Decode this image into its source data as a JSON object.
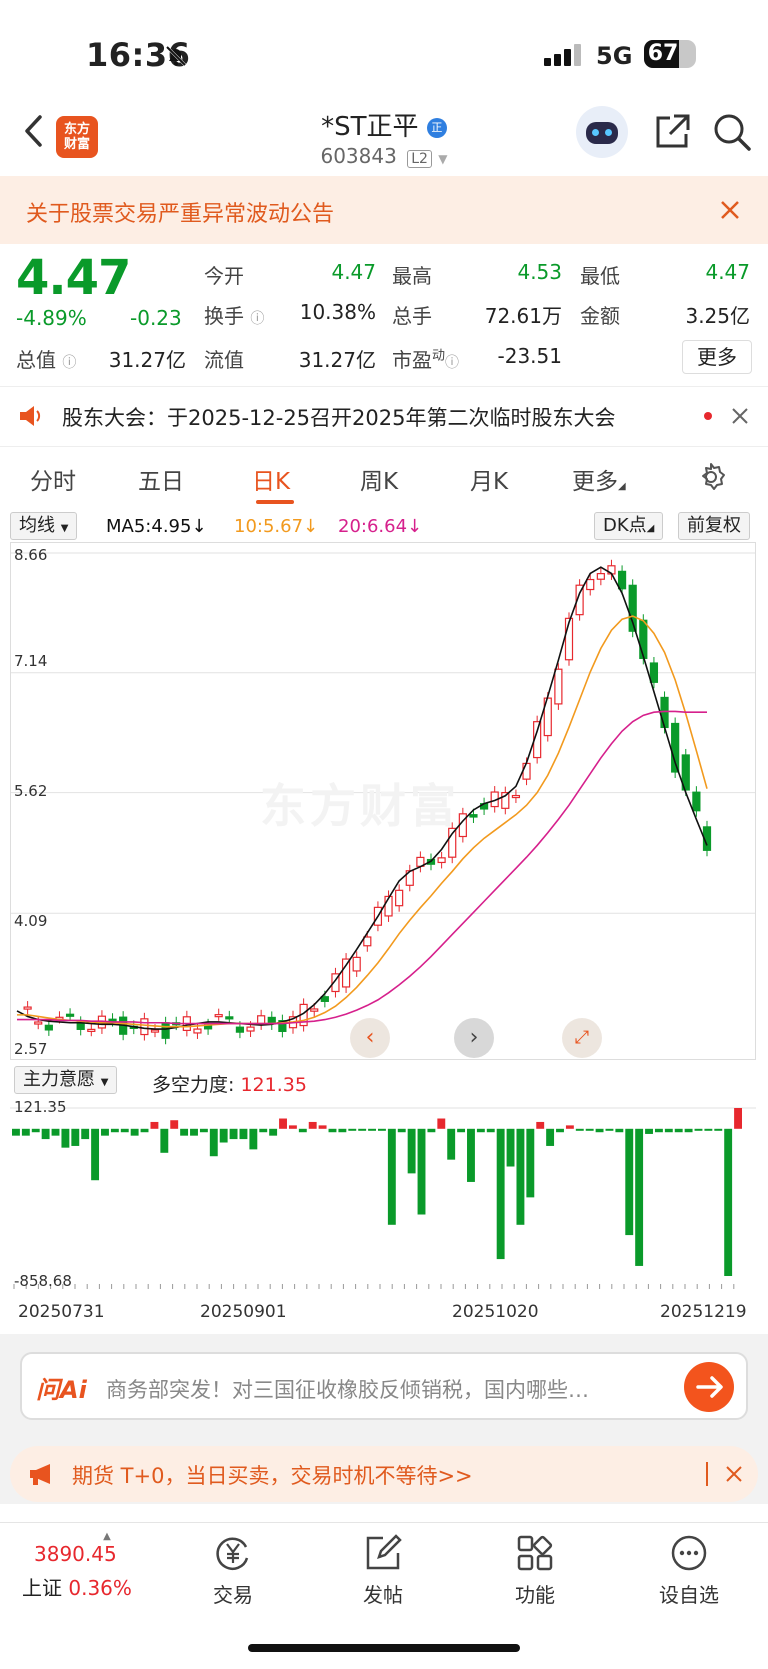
{
  "status": {
    "time": "16:36",
    "network": "5G",
    "battery": "67",
    "battery_level": 0.67
  },
  "header": {
    "logo_text_1": "东方",
    "logo_text_2": "财富",
    "stock_name": "*ST正平",
    "stock_code": "603843",
    "level_badge": "L2",
    "icons": [
      "back-icon",
      "robot-avatar-icon",
      "share-icon",
      "search-icon"
    ]
  },
  "notice": {
    "text": "关于股票交易严重异常波动公告"
  },
  "quote": {
    "price": "4.47",
    "change_pct": "-4.89%",
    "change": "-0.23",
    "open_label": "今开",
    "open": "4.47",
    "high_label": "最高",
    "high": "4.53",
    "low_label": "最低",
    "low": "4.47",
    "turnover_label": "换手",
    "turnover": "10.38%",
    "volume_label": "总手",
    "volume": "72.61万",
    "amount_label": "金额",
    "amount": "3.25亿",
    "total_mv_label": "总值",
    "total_mv": "31.27亿",
    "float_mv_label": "流值",
    "float_mv": "31.27亿",
    "pe_label": "市盈",
    "pe_sup": "动",
    "pe": "-23.51",
    "more_label": "更多"
  },
  "announcement": {
    "text": "股东大会：于2025-12-25召开2025年第二次临时股东大会"
  },
  "tabs": {
    "items": [
      "分时",
      "五日",
      "日K",
      "周K",
      "月K",
      "更多"
    ],
    "active": "日K"
  },
  "chart_header": {
    "indicator_select": "均线",
    "ma5": "MA5:4.95",
    "ma10": "10:5.67",
    "ma20": "20:6.64",
    "dk_label": "DK点",
    "adjust_label": "前复权"
  },
  "sub_header": {
    "indicator_select": "主力意愿",
    "label": "多空力度:",
    "value": "121.35"
  },
  "watermark": "东方财富",
  "colors": {
    "up": "#e7282e",
    "down": "#0a9a2a",
    "accent": "#e8541f",
    "ma5": "#111111",
    "ma10": "#f29a1e",
    "ma20": "#d6208c"
  },
  "chart_data": [
    {
      "type": "candlestick",
      "y_ticks": [
        "8.66",
        "7.14",
        "5.62",
        "4.09",
        "2.57"
      ],
      "ylim": [
        2.57,
        8.66
      ],
      "x_labels": [
        "20250731",
        "20250901",
        "20251020",
        "20251219"
      ],
      "series": [
        {
          "name": "MA5",
          "values": [
            2.85,
            2.78,
            2.74,
            2.72,
            2.71,
            2.7,
            2.7,
            2.69,
            2.68,
            2.68,
            2.67,
            2.65,
            2.63,
            2.62,
            2.62,
            2.64,
            2.67,
            2.69,
            2.71,
            2.71,
            2.7,
            2.69,
            2.68,
            2.67,
            2.68,
            2.71,
            2.75,
            2.82,
            2.93,
            3.07,
            3.24,
            3.43,
            3.63,
            3.84,
            4.05,
            4.28,
            4.5,
            4.62,
            4.68,
            4.75,
            4.9,
            5.1,
            5.26,
            5.4,
            5.48,
            5.52,
            5.58,
            5.7,
            6.0,
            6.4,
            6.84,
            7.3,
            7.78,
            8.15,
            8.4,
            8.48,
            8.4,
            8.15,
            7.78,
            7.35,
            6.9,
            6.45,
            6.0,
            5.62,
            5.28,
            4.95
          ]
        },
        {
          "name": "MA10",
          "values": [
            2.8,
            2.8,
            2.78,
            2.76,
            2.74,
            2.73,
            2.72,
            2.71,
            2.7,
            2.7,
            2.69,
            2.68,
            2.67,
            2.66,
            2.65,
            2.65,
            2.65,
            2.66,
            2.67,
            2.68,
            2.69,
            2.69,
            2.69,
            2.69,
            2.69,
            2.7,
            2.71,
            2.73,
            2.77,
            2.83,
            2.91,
            3.02,
            3.15,
            3.3,
            3.46,
            3.64,
            3.83,
            4.0,
            4.16,
            4.31,
            4.47,
            4.62,
            4.78,
            4.92,
            5.04,
            5.14,
            5.24,
            5.34,
            5.46,
            5.62,
            5.84,
            6.12,
            6.45,
            6.8,
            7.15,
            7.45,
            7.68,
            7.82,
            7.86,
            7.8,
            7.64,
            7.4,
            7.05,
            6.62,
            6.15,
            5.67
          ]
        },
        {
          "name": "MA20",
          "values": [
            2.74,
            2.74,
            2.74,
            2.74,
            2.73,
            2.73,
            2.73,
            2.72,
            2.72,
            2.71,
            2.71,
            2.71,
            2.7,
            2.7,
            2.7,
            2.69,
            2.69,
            2.69,
            2.69,
            2.69,
            2.69,
            2.69,
            2.69,
            2.69,
            2.69,
            2.69,
            2.7,
            2.71,
            2.72,
            2.74,
            2.77,
            2.81,
            2.86,
            2.92,
            2.99,
            3.08,
            3.18,
            3.29,
            3.41,
            3.54,
            3.68,
            3.82,
            3.96,
            4.1,
            4.24,
            4.38,
            4.52,
            4.66,
            4.8,
            4.95,
            5.11,
            5.28,
            5.46,
            5.66,
            5.86,
            6.06,
            6.24,
            6.4,
            6.52,
            6.6,
            6.64,
            6.65,
            6.65,
            6.64,
            6.64,
            6.64
          ]
        }
      ]
    },
    {
      "type": "bar",
      "title": "多空力度",
      "ylim": [
        -858.68,
        121.35
      ],
      "y_ticks": [
        "121.35",
        "-858.68"
      ],
      "values": [
        -40,
        -40,
        -20,
        -60,
        -40,
        -110,
        -100,
        -60,
        -300,
        -40,
        -20,
        -20,
        -40,
        -20,
        40,
        -140,
        50,
        -40,
        -40,
        -20,
        -160,
        -80,
        -60,
        -60,
        -120,
        -20,
        -40,
        60,
        20,
        -20,
        40,
        20,
        -20,
        -20,
        -10,
        -10,
        -10,
        -10,
        -560,
        -20,
        -260,
        -500,
        -20,
        60,
        -180,
        -20,
        -310,
        -20,
        -20,
        -760,
        -220,
        -560,
        -400,
        40,
        -100,
        -20,
        20,
        -10,
        -10,
        -20,
        -10,
        -20,
        -620,
        -800,
        -30,
        -20,
        -20,
        -20,
        -20,
        -10,
        -10,
        -10,
        -858.68,
        121.35
      ]
    }
  ],
  "ai_bar": {
    "logo": "问Ai",
    "text": "商务部突发！对三国征收橡胶反倾销税，国内哪些…"
  },
  "promo": {
    "text": "期货 T+0，当日买卖，交易时机不等待>>"
  },
  "bottom_nav": {
    "index_value": "3890.45",
    "index_name": "上证",
    "index_change": "0.36%",
    "items": [
      "交易",
      "发帖",
      "功能",
      "设自选"
    ]
  }
}
